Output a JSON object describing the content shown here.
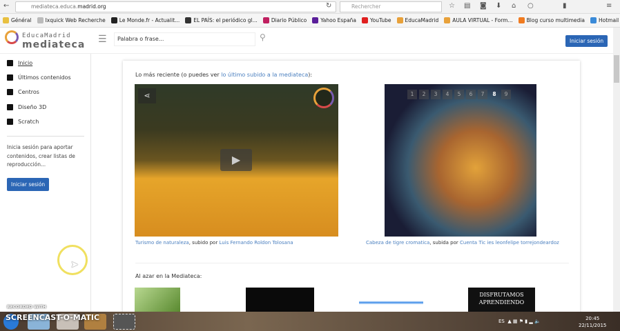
{
  "browser": {
    "url_host": "mediateca.educa.",
    "url_domain": "madrid.org",
    "search_placeholder": "Rechercher",
    "bookmarks": [
      "Général",
      "Ixquick Web Recherche",
      "Le Monde.fr - Actualit...",
      "EL PAÍS: el periódico gl...",
      "Diario Público",
      "Yahoo España",
      "YouTube",
      "EducaMadrid",
      "AULA VIRTUAL - Form...",
      "Blog curso multimedia",
      "Hotmail"
    ],
    "bookmark_colors": [
      "#e8c040",
      "#bbbbbb",
      "#222222",
      "#333333",
      "#c02060",
      "#5a1f9a",
      "#e02020",
      "#e8a13a",
      "#e8a13a",
      "#f07b20",
      "#3a8ad8"
    ]
  },
  "header": {
    "logo_top": "EducaMadrid",
    "logo_bottom": "mediateca",
    "search_placeholder": "Palabra o frase...",
    "login": "Iniciar sesión"
  },
  "sidebar": {
    "items": [
      "Inicio",
      "Últimos contenidos",
      "Centros",
      "Diseño 3D",
      "Scratch"
    ],
    "login_text": "Inicia sesión para aportar contenidos, crear listas de reproducción...",
    "login_button": "Iniciar sesión"
  },
  "main": {
    "recent_prefix": "Lo más reciente (o puedes ver ",
    "recent_link": "lo último subido a la mediateca",
    "recent_suffix": "):",
    "pages": [
      "1",
      "2",
      "3",
      "4",
      "5",
      "6",
      "7",
      "8",
      "9"
    ],
    "active_page": "8",
    "video_caption": {
      "title": "Turismo de naturaleza",
      "by": ", subido por ",
      "author": "Luis Fernando Roldon Tolosana"
    },
    "image_caption": {
      "title": "Cabeza de tigre cromatica",
      "by": ", subida por ",
      "author": "Cuenta Tic ies leonfelipe torrejondeardoz"
    },
    "random_title": "Al azar en la Mediateca:",
    "thumb_text_1": "DISFRUTAMOS",
    "thumb_text_2": "APRENDIENDO"
  },
  "watermark": {
    "line1": "RECORDED WITH",
    "line2": "SCREENCAST-O-MATIC"
  },
  "taskbar": {
    "lang": "ES",
    "time": "20:45",
    "date": "22/11/2015"
  },
  "accent": "#2b66b5"
}
